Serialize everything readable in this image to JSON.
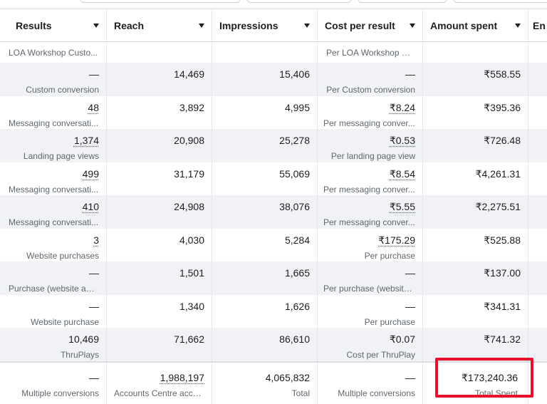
{
  "columns": [
    {
      "label": "Results"
    },
    {
      "label": "Reach"
    },
    {
      "label": "Impressions"
    },
    {
      "label": "Cost per result"
    },
    {
      "label": "Amount spent"
    },
    {
      "label": "En"
    }
  ],
  "partial_row": {
    "results_sub": "LOA Workshop Custo...",
    "cost_sub": "Per LOA Workshop Cu..."
  },
  "rows": [
    {
      "results": "—",
      "results_sub": "Custom conversion",
      "reach": "14,469",
      "impressions": "15,406",
      "cost": "—",
      "cost_sub": "Per Custom conversion",
      "spent": "₹558.55"
    },
    {
      "results": "48",
      "results_sub": "Messaging conversati...",
      "reach": "3,892",
      "impressions": "4,995",
      "cost": "₹8.24",
      "cost_sub": "Per messaging conver...",
      "spent": "₹395.36"
    },
    {
      "results": "1,374",
      "results_sub": "Landing page views",
      "reach": "20,908",
      "impressions": "25,278",
      "cost": "₹0.53",
      "cost_sub": "Per landing page view",
      "spent": "₹726.48"
    },
    {
      "results": "499",
      "results_sub": "Messaging conversati...",
      "reach": "31,179",
      "impressions": "55,069",
      "cost": "₹8.54",
      "cost_sub": "Per messaging conver...",
      "spent": "₹4,261.31"
    },
    {
      "results": "410",
      "results_sub": "Messaging conversati...",
      "reach": "24,908",
      "impressions": "38,076",
      "cost": "₹5.55",
      "cost_sub": "Per messaging conver...",
      "spent": "₹2,275.51"
    },
    {
      "results": "3",
      "results_sub": "Website purchases",
      "reach": "4,030",
      "impressions": "5,284",
      "cost": "₹175.29",
      "cost_sub": "Per purchase",
      "spent": "₹525.88"
    },
    {
      "results": "—",
      "results_sub": "Purchase (website and...",
      "reach": "1,501",
      "impressions": "1,665",
      "cost": "—",
      "cost_sub": "Per purchase (website ...",
      "spent": "₹137.00"
    },
    {
      "results": "—",
      "results_sub": "Website purchase",
      "reach": "1,340",
      "impressions": "1,626",
      "cost": "—",
      "cost_sub": "Per purchase",
      "spent": "₹341.31"
    },
    {
      "results": "10,469",
      "results_sub": "ThruPlays",
      "reach": "71,662",
      "impressions": "86,610",
      "cost": "₹0.07",
      "cost_sub": "Cost per ThruPlay",
      "spent": "₹741.32"
    }
  ],
  "total": {
    "results": "—",
    "results_sub": "Multiple conversions",
    "reach": "1,988,197",
    "reach_sub": "Accounts Centre acco...",
    "impressions": "4,065,832",
    "impressions_sub": "Total",
    "cost": "—",
    "cost_sub": "Multiple conversions",
    "spent": "₹173,240.36",
    "spent_sub": "Total Spent"
  },
  "highlight_color": "#e8102a"
}
